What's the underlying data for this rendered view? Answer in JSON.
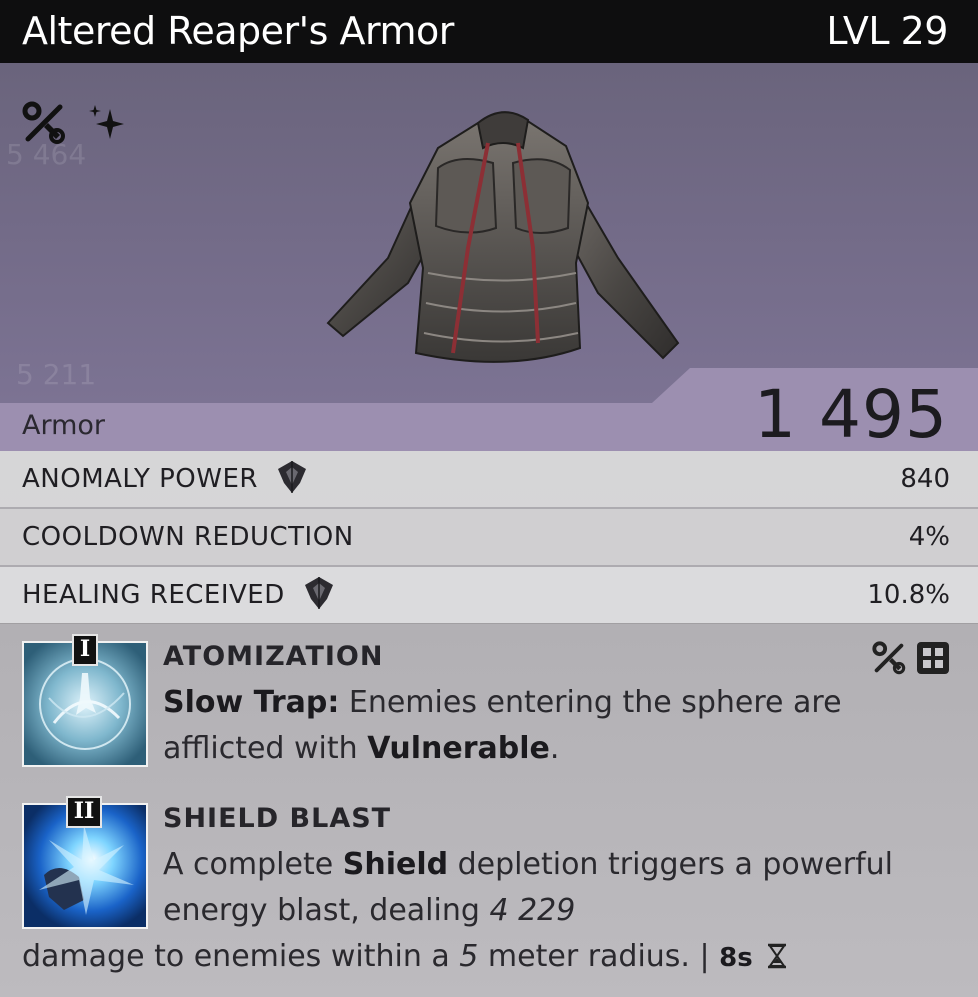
{
  "item": {
    "name": "Altered Reaper's Armor",
    "level": "LVL 29",
    "category": "Armor",
    "armor_value": "1 495",
    "bg_numbers": [
      "5 464",
      "5 211"
    ]
  },
  "stats": [
    {
      "label": "ANOMALY POWER",
      "value": "840",
      "has_icon": true
    },
    {
      "label": "COOLDOWN REDUCTION",
      "value": "4%",
      "has_icon": false
    },
    {
      "label": "HEALING RECEIVED",
      "value": "10.8%",
      "has_icon": true
    }
  ],
  "abilities": [
    {
      "tier": "I",
      "name": "ATOMIZATION",
      "desc": {
        "bold1": "Slow Trap:",
        "text1": " Enemies entering the sphere are afflicted with ",
        "bold2": "Vulnerable",
        "text2": "."
      },
      "icons": [
        "wrench-cross-icon",
        "grid-icon"
      ]
    },
    {
      "tier": "II",
      "name": "SHIELD BLAST",
      "desc": {
        "text1": "A complete ",
        "bold1": "Shield",
        "text2": " depletion triggers a powerful energy blast, dealing ",
        "italic1": "4 229",
        "text3": " damage to enemies within a ",
        "italic2": "5",
        "text4": " meter radius. | ",
        "cooldown": "8s"
      }
    }
  ],
  "colors": {
    "header_bg": "#0e0e0f",
    "hero_bg": "#736b88",
    "category_band": "#9c8fb0"
  },
  "icons": {
    "top_left": [
      "wrench-cross-icon",
      "sparkle-icon"
    ],
    "stat": "diamond-shield-icon",
    "cooldown": "hourglass-icon"
  }
}
